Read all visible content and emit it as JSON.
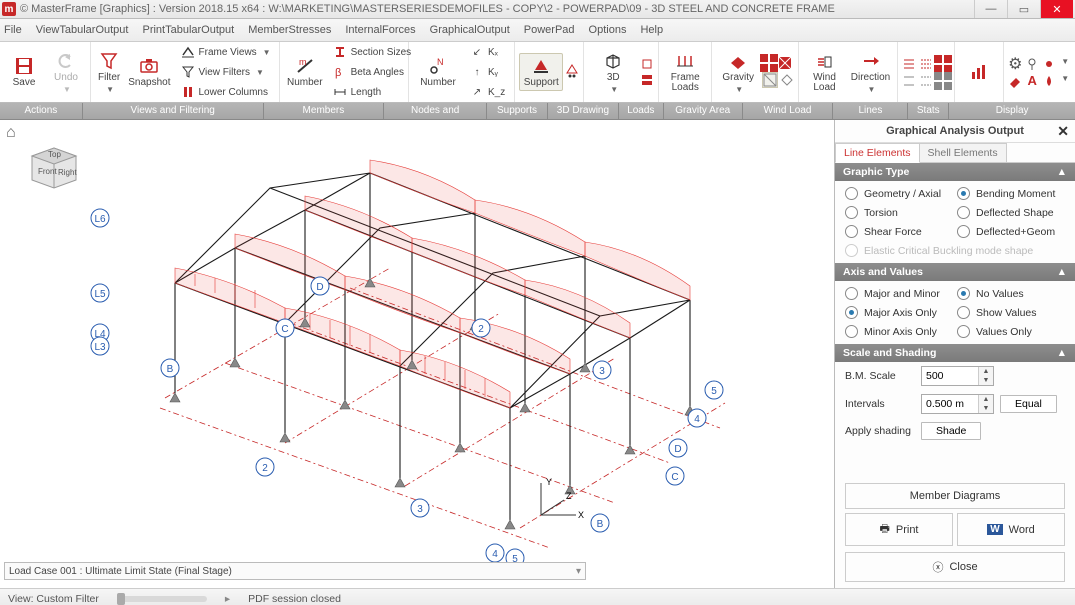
{
  "titlebar": {
    "app": "© MasterFrame [Graphics] : Version 2018.15 x64 :",
    "path": "W:\\MARKETING\\MASTERSERIESDEMOFILES - COPY\\2 - POWERPAD\\09 - 3D STEEL AND CONCRETE FRAME"
  },
  "menu": [
    "File",
    "ViewTabularOutput",
    "PrintTabularOutput",
    "MemberStresses",
    "InternalForces",
    "GraphicalOutput",
    "PowerPad",
    "Options",
    "Help"
  ],
  "ribbon": {
    "save": "Save",
    "undo": "Undo",
    "filter": "Filter",
    "snapshot": "Snapshot",
    "frameviews": "Frame Views",
    "viewfilters": "View Filters",
    "lowercols": "Lower Columns",
    "number_m": "Number",
    "section": "Section Sizes",
    "beta": "Beta Angles",
    "length": "Length",
    "number_n": "Number",
    "kx": "Kₓ",
    "ky": "Kᵧ",
    "kz": "K_z",
    "support": "Support",
    "threeD": "3D",
    "frameloads": "Frame Loads",
    "gravity": "Gravity",
    "windload": "Wind Load",
    "direction": "Direction"
  },
  "groups": [
    "Actions",
    "Views and Filtering",
    "Members",
    "Nodes and Coordinates",
    "Supports",
    "3D Drawing",
    "Loads",
    "Gravity Area Load",
    "Wind Load",
    "Lines",
    "Stats",
    "Display"
  ],
  "groupWidths": [
    82,
    180,
    120,
    102,
    60,
    70,
    44,
    78,
    90,
    74,
    40,
    126
  ],
  "side": {
    "title": "Graphical Analysis Output",
    "tabs": {
      "line": "Line Elements",
      "shell": "Shell Elements"
    },
    "s1": {
      "head": "Graphic Type",
      "opts": [
        "Geometry / Axial",
        "Bending Moment",
        "Torsion",
        "Deflected Shape",
        "Shear Force",
        "Deflected+Geom"
      ],
      "dis": "Elastic Critical Buckling mode shape"
    },
    "s2": {
      "head": "Axis and Values",
      "opts": [
        "Major and Minor",
        "No Values",
        "Major Axis Only",
        "Show Values",
        "Minor Axis Only",
        "Values Only"
      ]
    },
    "s3": {
      "head": "Scale and Shading",
      "bmscale_lbl": "B.M. Scale",
      "bmscale_val": "500",
      "int_lbl": "Intervals",
      "int_val": "0.500 m",
      "equal": "Equal",
      "apply_lbl": "Apply shading",
      "shade": "Shade"
    },
    "memdiag": "Member Diagrams",
    "print": "Print",
    "word": "Word",
    "close": "Close"
  },
  "viewport": {
    "home": "⌂",
    "cube": {
      "front": "Front",
      "top": "Top",
      "right": "Right"
    },
    "loadcase": "Load Case 001 : Ultimate Limit State (Final Stage)",
    "labels": [
      "L6",
      "L5",
      "L4",
      "L3",
      "B",
      "2",
      "C",
      "D",
      "3",
      "4",
      "5",
      "B",
      "C",
      "D",
      "2",
      "3",
      "4",
      "5"
    ]
  },
  "status": {
    "view": "View: Custom Filter",
    "pdf": "PDF session closed"
  },
  "colors": {
    "accent": "#c62828",
    "panelhead": "#7a7a7a"
  }
}
